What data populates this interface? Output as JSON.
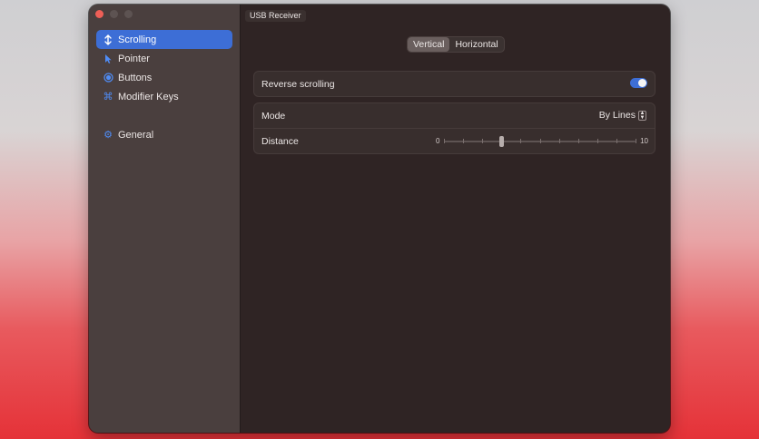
{
  "window": {
    "device_tab": "USB Receiver"
  },
  "sidebar": {
    "items": [
      {
        "label": "Scrolling",
        "icon": "arrow-up-down-icon",
        "active": true
      },
      {
        "label": "Pointer",
        "icon": "cursor-icon",
        "active": false
      },
      {
        "label": "Buttons",
        "icon": "circle-button-icon",
        "active": false
      },
      {
        "label": "Modifier Keys",
        "icon": "command-key-icon",
        "active": false
      },
      {
        "label": "General",
        "icon": "gear-icon",
        "active": false
      }
    ]
  },
  "direction_tabs": {
    "vertical": "Vertical",
    "horizontal": "Horizontal",
    "selected": "Vertical"
  },
  "settings": {
    "reverse_label": "Reverse scrolling",
    "reverse_enabled": true,
    "mode_label": "Mode",
    "mode_value": "By Lines",
    "distance_label": "Distance",
    "distance_min": "0",
    "distance_max": "10",
    "distance_value": 3
  },
  "colors": {
    "accent": "#3d6ed6",
    "close": "#ee5f57"
  }
}
